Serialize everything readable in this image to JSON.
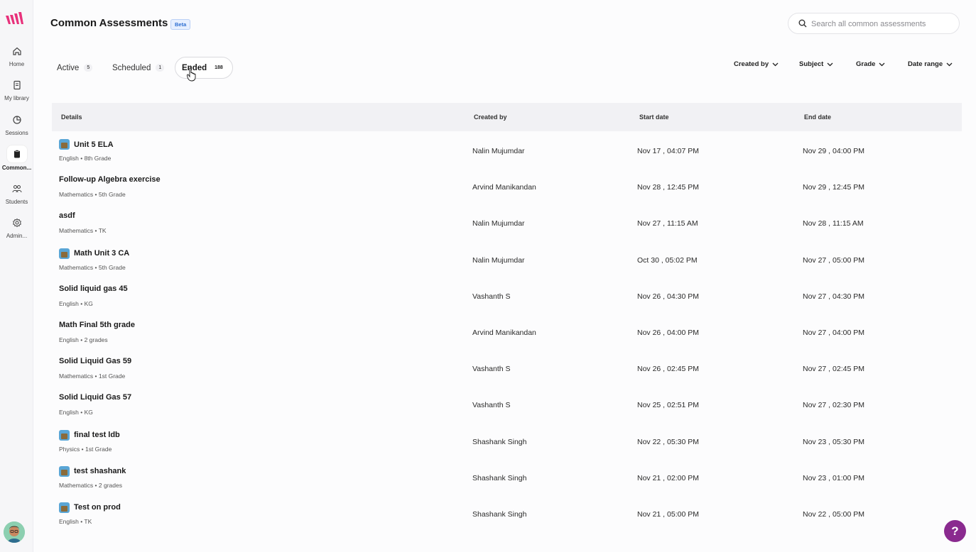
{
  "app": {
    "brand_color": "#e8317b",
    "accent": "#8a2a8f"
  },
  "sidebar": {
    "items": [
      {
        "label": "Home",
        "icon": "home-icon"
      },
      {
        "label": "My library",
        "icon": "library-icon"
      },
      {
        "label": "Sessions",
        "icon": "sessions-icon"
      },
      {
        "label": "Common...",
        "icon": "clipboard-icon",
        "active": true
      },
      {
        "label": "Students",
        "icon": "students-icon"
      },
      {
        "label": "Admin...",
        "icon": "gear-icon"
      }
    ]
  },
  "header": {
    "title": "Common Assessments",
    "badge": "Beta",
    "search_placeholder": "Search all common assessments"
  },
  "tabs": [
    {
      "label": "Active",
      "count": "5"
    },
    {
      "label": "Scheduled",
      "count": "1"
    },
    {
      "label": "Ended",
      "count": "188",
      "active": true
    }
  ],
  "filters": {
    "created_by": "Created by",
    "subject": "Subject",
    "grade": "Grade",
    "date_range": "Date range"
  },
  "table": {
    "headers": {
      "details": "Details",
      "created_by": "Created by",
      "start_date": "Start date",
      "end_date": "End date"
    },
    "rows": [
      {
        "title": "Unit 5 ELA",
        "meta": "English • 8th Grade",
        "thumb": true,
        "created_by": "Nalin Mujumdar",
        "start": "Nov 17 , 04:07 PM",
        "end": "Nov 29 , 04:00 PM"
      },
      {
        "title": "Follow-up Algebra exercise",
        "meta": "Mathematics • 5th Grade",
        "thumb": false,
        "created_by": "Arvind Manikandan",
        "start": "Nov 28 , 12:45 PM",
        "end": "Nov 29 , 12:45 PM"
      },
      {
        "title": "asdf",
        "meta": "Mathematics • TK",
        "thumb": false,
        "created_by": "Nalin Mujumdar",
        "start": "Nov 27 , 11:15 AM",
        "end": "Nov 28 , 11:15 AM"
      },
      {
        "title": "Math Unit 3 CA",
        "meta": "Mathematics • 5th Grade",
        "thumb": true,
        "created_by": "Nalin Mujumdar",
        "start": "Oct 30 , 05:02 PM",
        "end": "Nov 27 , 05:00 PM"
      },
      {
        "title": "Solid liquid gas 45",
        "meta": "English • KG",
        "thumb": false,
        "created_by": "Vashanth S",
        "start": "Nov 26 , 04:30 PM",
        "end": "Nov 27 , 04:30 PM"
      },
      {
        "title": "Math Final 5th grade",
        "meta": "English • 2 grades",
        "thumb": false,
        "created_by": "Arvind Manikandan",
        "start": "Nov 26 , 04:00 PM",
        "end": "Nov 27 , 04:00 PM"
      },
      {
        "title": "Solid Liquid Gas 59",
        "meta": "Mathematics • 1st Grade",
        "thumb": false,
        "created_by": "Vashanth S",
        "start": "Nov 26 , 02:45 PM",
        "end": "Nov 27 , 02:45 PM"
      },
      {
        "title": "Solid Liquid Gas 57",
        "meta": "English • KG",
        "thumb": false,
        "created_by": "Vashanth S",
        "start": "Nov 25 , 02:51 PM",
        "end": "Nov 27 , 02:30 PM"
      },
      {
        "title": "final test ldb",
        "meta": "Physics • 1st Grade",
        "thumb": true,
        "created_by": "Shashank Singh",
        "start": "Nov 22 , 05:30 PM",
        "end": "Nov 23 , 05:30 PM"
      },
      {
        "title": "test shashank",
        "meta": "Mathematics • 2 grades",
        "thumb": true,
        "created_by": "Shashank Singh",
        "start": "Nov 21 , 02:00 PM",
        "end": "Nov 23 , 01:00 PM"
      },
      {
        "title": "Test on prod",
        "meta": "English • TK",
        "thumb": true,
        "created_by": "Shashank Singh",
        "start": "Nov 21 , 05:00 PM",
        "end": "Nov 22 , 05:00 PM"
      }
    ]
  },
  "help": {
    "label": "?"
  }
}
